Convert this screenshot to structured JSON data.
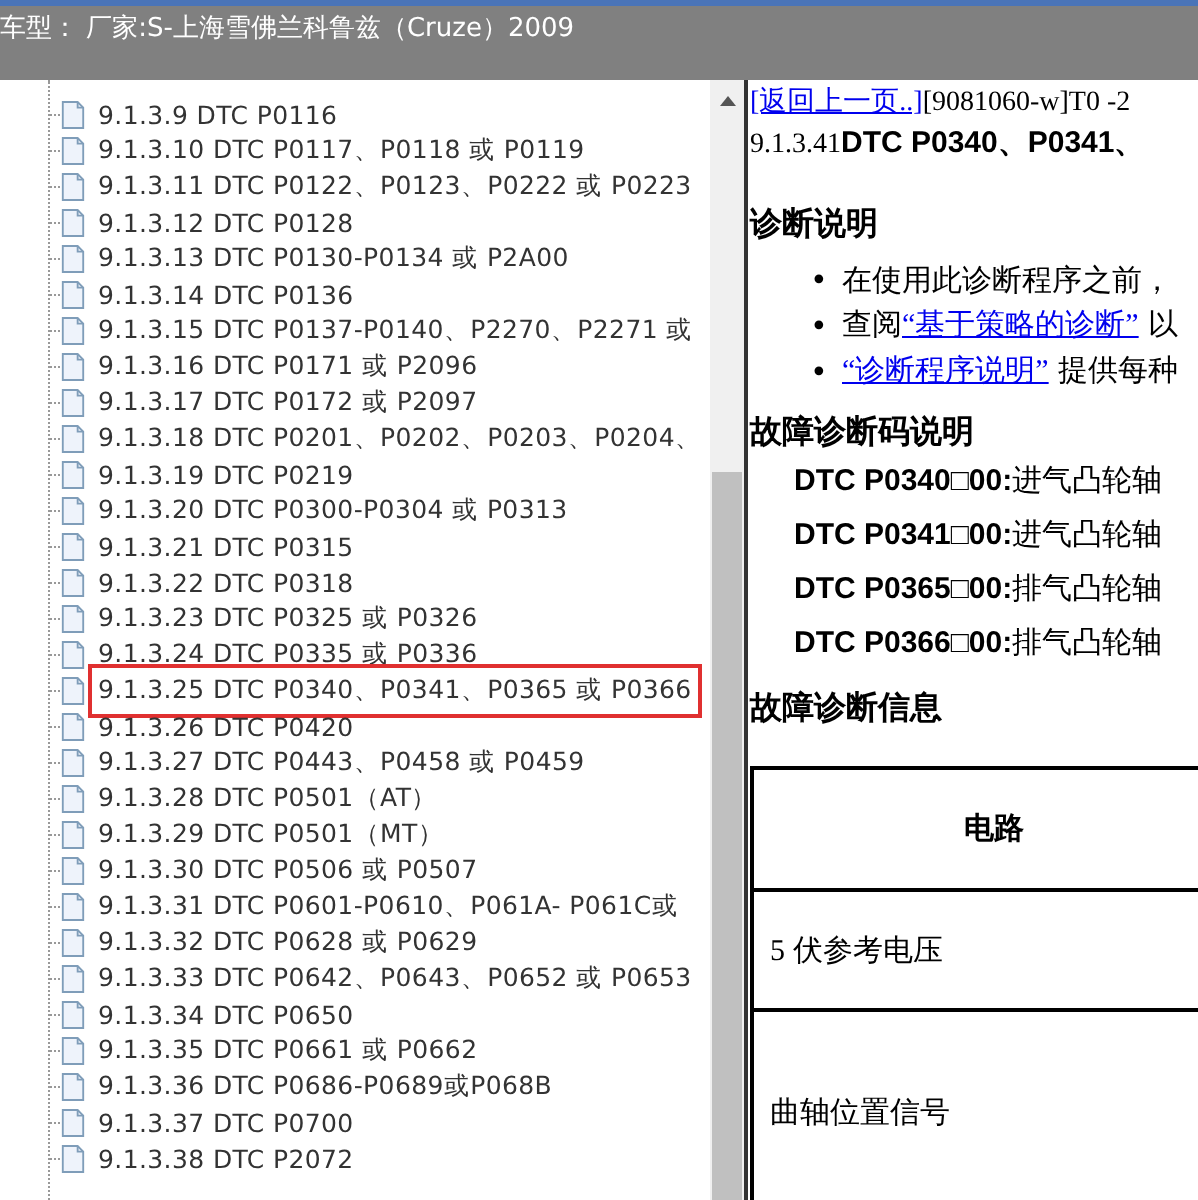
{
  "header": {
    "title": "车型： 厂家:S-上海雪佛兰科鲁兹（Cruze）2009"
  },
  "tree": {
    "items": [
      {
        "label": "9.1.3.9 DTC P0116",
        "selected": false
      },
      {
        "label": "9.1.3.10 DTC P0117、P0118 或 P0119",
        "selected": false
      },
      {
        "label": "9.1.3.11 DTC P0122、P0123、P0222 或 P0223",
        "selected": false
      },
      {
        "label": "9.1.3.12 DTC P0128",
        "selected": false
      },
      {
        "label": "9.1.3.13 DTC P0130-P0134 或 P2A00",
        "selected": false
      },
      {
        "label": "9.1.3.14 DTC P0136",
        "selected": false
      },
      {
        "label": "9.1.3.15 DTC P0137-P0140、P2270、P2271 或",
        "selected": false
      },
      {
        "label": "9.1.3.16 DTC P0171 或 P2096",
        "selected": false
      },
      {
        "label": "9.1.3.17 DTC P0172 或 P2097",
        "selected": false
      },
      {
        "label": "9.1.3.18 DTC P0201、P0202、P0203、P0204、",
        "selected": false
      },
      {
        "label": "9.1.3.19 DTC P0219",
        "selected": false
      },
      {
        "label": "9.1.3.20 DTC P0300-P0304 或 P0313",
        "selected": false
      },
      {
        "label": "9.1.3.21 DTC P0315",
        "selected": false
      },
      {
        "label": "9.1.3.22 DTC P0318",
        "selected": false
      },
      {
        "label": "9.1.3.23 DTC P0325 或 P0326",
        "selected": false
      },
      {
        "label": "9.1.3.24 DTC P0335 或 P0336",
        "selected": false
      },
      {
        "label": "9.1.3.25 DTC P0340、P0341、P0365 或 P0366",
        "selected": true
      },
      {
        "label": "9.1.3.26 DTC P0420",
        "selected": false
      },
      {
        "label": "9.1.3.27 DTC P0443、P0458 或 P0459",
        "selected": false
      },
      {
        "label": "9.1.3.28 DTC P0501（AT）",
        "selected": false
      },
      {
        "label": "9.1.3.29 DTC P0501（MT）",
        "selected": false
      },
      {
        "label": "9.1.3.30 DTC P0506 或 P0507",
        "selected": false
      },
      {
        "label": "9.1.3.31 DTC P0601-P0610、P061A- P061C或",
        "selected": false
      },
      {
        "label": "9.1.3.32 DTC P0628 或 P0629",
        "selected": false
      },
      {
        "label": "9.1.3.33 DTC P0642、P0643、P0652 或 P0653",
        "selected": false
      },
      {
        "label": "9.1.3.34 DTC P0650",
        "selected": false
      },
      {
        "label": "9.1.3.35 DTC P0661 或 P0662",
        "selected": false
      },
      {
        "label": "9.1.3.36 DTC P0686-P0689或P068B",
        "selected": false
      },
      {
        "label": "9.1.3.37 DTC P0700",
        "selected": false
      },
      {
        "label": "9.1.3.38 DTC P2072",
        "selected": false
      }
    ]
  },
  "document": {
    "back_link": "[返回上一页..]",
    "doc_id": "[9081060-w]T0 -2",
    "title_number": "9.1.3.41",
    "title": "DTC P0340、P0341、",
    "section_1": "诊断说明",
    "bullets": [
      {
        "marker": "•",
        "parts": [
          {
            "kind": "text",
            "text": "在使用此诊断程序之前，"
          }
        ]
      },
      {
        "marker": "•",
        "parts": [
          {
            "kind": "text",
            "text": "查阅"
          },
          {
            "kind": "link",
            "text": "“基于策略的诊断”"
          },
          {
            "kind": "text",
            "text": " 以"
          }
        ]
      },
      {
        "marker": "•",
        "parts": [
          {
            "kind": "link",
            "text": "“诊断程序说明”"
          },
          {
            "kind": "text",
            "text": " 提供每种"
          }
        ]
      }
    ],
    "section_2": "故障诊断码说明",
    "codes": [
      {
        "code": "DTC P0340□00:",
        "description": "进气凸轮轴"
      },
      {
        "code": "DTC P0341□00:",
        "description": "进气凸轮轴"
      },
      {
        "code": "DTC P0365□00:",
        "description": "排气凸轮轴"
      },
      {
        "code": "DTC P0366□00:",
        "description": "排气凸轮轴"
      }
    ],
    "section_3": "故障诊断信息",
    "table": {
      "header": "电路",
      "rows": [
        "5 伏参考电压",
        "曲轴位置信号"
      ]
    }
  }
}
